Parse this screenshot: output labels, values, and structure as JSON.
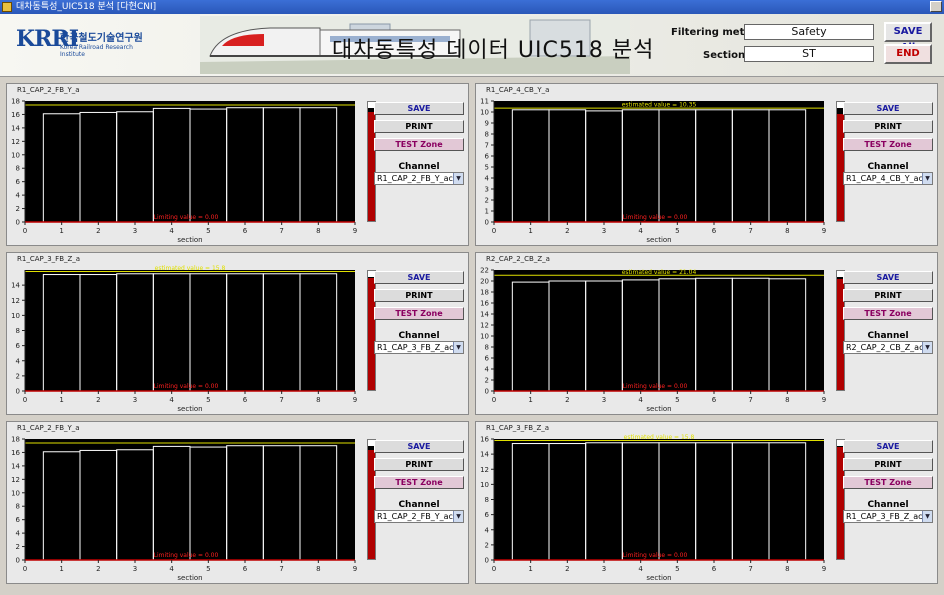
{
  "window": {
    "title": "대차동특성_UIC518 분석 [다현CNI]"
  },
  "header": {
    "logo_mark": "KRRI",
    "logo_korean": "한국철도기술연구원",
    "logo_english": "Korea Railroad Research Institute",
    "app_title": "대차동특성 데이터 UIC518 분석",
    "filtering_label": "Filtering method",
    "filtering_value": "Safety",
    "section_label": "Section",
    "section_value": "ST",
    "save_all_label": "SAVE All",
    "end_label": "END"
  },
  "buttons": {
    "save": "SAVE",
    "print": "PRINT",
    "test": "TEST Zone",
    "channel_label": "Channel"
  },
  "colors": {
    "plot_bg": "#000000",
    "bar_outline": "#ffffff",
    "estimate_line": "#e0e000",
    "limit_text": "#ff2020",
    "level_bar": "#b00000"
  },
  "panels": [
    {
      "title": "R1_CAP_2_FB_Y_a",
      "channel": "R1_CAP_2_FB_Y_ac",
      "chart_data": {
        "type": "bar",
        "x_ticks": [
          0,
          1,
          2,
          3,
          4,
          5,
          6,
          7,
          8,
          9
        ],
        "xlabel": "section",
        "ylim": [
          0,
          18
        ],
        "y_ticks": [
          0,
          2,
          4,
          6,
          8,
          10,
          12,
          14,
          16,
          18
        ],
        "grid": false,
        "bars": [
          {
            "x": 1,
            "y": 16.1
          },
          {
            "x": 2,
            "y": 16.3
          },
          {
            "x": 3,
            "y": 16.4
          },
          {
            "x": 4,
            "y": 16.9
          },
          {
            "x": 5,
            "y": 16.8
          },
          {
            "x": 6,
            "y": 17.0
          },
          {
            "x": 7,
            "y": 17.0
          },
          {
            "x": 8,
            "y": 17.0
          }
        ],
        "estimate_line": 17.4,
        "estimate_label": "",
        "limit_label": "Limiting value = 0.00"
      },
      "level": 0.92
    },
    {
      "title": "R1_CAP_4_CB_Y_a",
      "channel": "R1_CAP_4_CB_Y_ac",
      "chart_data": {
        "type": "bar",
        "x_ticks": [
          0,
          1,
          2,
          3,
          4,
          5,
          6,
          7,
          8,
          9
        ],
        "xlabel": "section",
        "ylim": [
          0,
          11
        ],
        "y_ticks": [
          0,
          1,
          2,
          3,
          4,
          5,
          6,
          7,
          8,
          9,
          10,
          11
        ],
        "grid": false,
        "bars": [
          {
            "x": 1,
            "y": 10.2
          },
          {
            "x": 2,
            "y": 10.2
          },
          {
            "x": 3,
            "y": 10.1
          },
          {
            "x": 4,
            "y": 10.2
          },
          {
            "x": 5,
            "y": 10.2
          },
          {
            "x": 6,
            "y": 10.2
          },
          {
            "x": 7,
            "y": 10.2
          },
          {
            "x": 8,
            "y": 10.2
          }
        ],
        "estimate_line": 10.35,
        "estimate_label": "estimated value = 10.35",
        "limit_label": "Limiting value = 0.00"
      },
      "level": 0.9
    },
    {
      "title": "R1_CAP_3_FB_Z_a",
      "channel": "R1_CAP_3_FB_Z_ac",
      "chart_data": {
        "type": "bar",
        "x_ticks": [
          0,
          1,
          2,
          3,
          4,
          5,
          6,
          7,
          8,
          9
        ],
        "xlabel": "section",
        "ylim": [
          0,
          16
        ],
        "y_ticks": [
          0,
          2,
          4,
          6,
          8,
          10,
          12,
          14
        ],
        "grid": false,
        "bars": [
          {
            "x": 1,
            "y": 15.4
          },
          {
            "x": 2,
            "y": 15.4
          },
          {
            "x": 3,
            "y": 15.5
          },
          {
            "x": 4,
            "y": 15.5
          },
          {
            "x": 5,
            "y": 15.5
          },
          {
            "x": 6,
            "y": 15.5
          },
          {
            "x": 7,
            "y": 15.5
          },
          {
            "x": 8,
            "y": 15.5
          }
        ],
        "estimate_line": 15.8,
        "estimate_label": "estimated value = 15.8",
        "limit_label": "Limiting value = 0.00"
      },
      "level": 0.94
    },
    {
      "title": "R2_CAP_2_CB_Z_a",
      "channel": "R2_CAP_2_CB_Z_ac",
      "chart_data": {
        "type": "bar",
        "x_ticks": [
          0,
          1,
          2,
          3,
          4,
          5,
          6,
          7,
          8,
          9
        ],
        "xlabel": "section",
        "ylim": [
          0,
          22
        ],
        "y_ticks": [
          0,
          2,
          4,
          6,
          8,
          10,
          12,
          14,
          16,
          18,
          20,
          22
        ],
        "grid": false,
        "bars": [
          {
            "x": 1,
            "y": 19.8
          },
          {
            "x": 2,
            "y": 20.0
          },
          {
            "x": 3,
            "y": 20.0
          },
          {
            "x": 4,
            "y": 20.2
          },
          {
            "x": 5,
            "y": 20.4
          },
          {
            "x": 6,
            "y": 20.5
          },
          {
            "x": 7,
            "y": 20.5
          },
          {
            "x": 8,
            "y": 20.4
          }
        ],
        "estimate_line": 21.04,
        "estimate_label": "estimated value = 21.04",
        "limit_label": "Limiting value = 0.00"
      },
      "level": 0.93
    },
    {
      "title": "R1_CAP_2_FB_Y_a",
      "channel": "R1_CAP_2_FB_Y_ac",
      "chart_data": {
        "type": "bar",
        "x_ticks": [
          0,
          1,
          2,
          3,
          4,
          5,
          6,
          7,
          8,
          9
        ],
        "xlabel": "section",
        "ylim": [
          0,
          18
        ],
        "y_ticks": [
          0,
          2,
          4,
          6,
          8,
          10,
          12,
          14,
          16,
          18
        ],
        "grid": false,
        "bars": [
          {
            "x": 1,
            "y": 16.1
          },
          {
            "x": 2,
            "y": 16.3
          },
          {
            "x": 3,
            "y": 16.4
          },
          {
            "x": 4,
            "y": 16.9
          },
          {
            "x": 5,
            "y": 16.8
          },
          {
            "x": 6,
            "y": 17.0
          },
          {
            "x": 7,
            "y": 17.0
          },
          {
            "x": 8,
            "y": 17.0
          }
        ],
        "estimate_line": 17.4,
        "estimate_label": "",
        "limit_label": "Limiting value = 0.00"
      },
      "level": 0.92
    },
    {
      "title": "R1_CAP_3_FB_Z_a",
      "channel": "R1_CAP_3_FB_Z_ac",
      "chart_data": {
        "type": "bar",
        "x_ticks": [
          0,
          1,
          2,
          3,
          4,
          5,
          6,
          7,
          8,
          9
        ],
        "xlabel": "section",
        "ylim": [
          0,
          16
        ],
        "y_ticks": [
          0,
          2,
          4,
          6,
          8,
          10,
          12,
          14,
          16
        ],
        "grid": false,
        "bars": [
          {
            "x": 1,
            "y": 15.4
          },
          {
            "x": 2,
            "y": 15.4
          },
          {
            "x": 3,
            "y": 15.5
          },
          {
            "x": 4,
            "y": 15.5
          },
          {
            "x": 5,
            "y": 15.5
          },
          {
            "x": 6,
            "y": 15.5
          },
          {
            "x": 7,
            "y": 15.5
          },
          {
            "x": 8,
            "y": 15.5
          }
        ],
        "estimate_line": 15.8,
        "estimate_label": "estimated value = 15.8",
        "limit_label": "Limiting value = 0.00"
      },
      "level": 0.94
    }
  ]
}
